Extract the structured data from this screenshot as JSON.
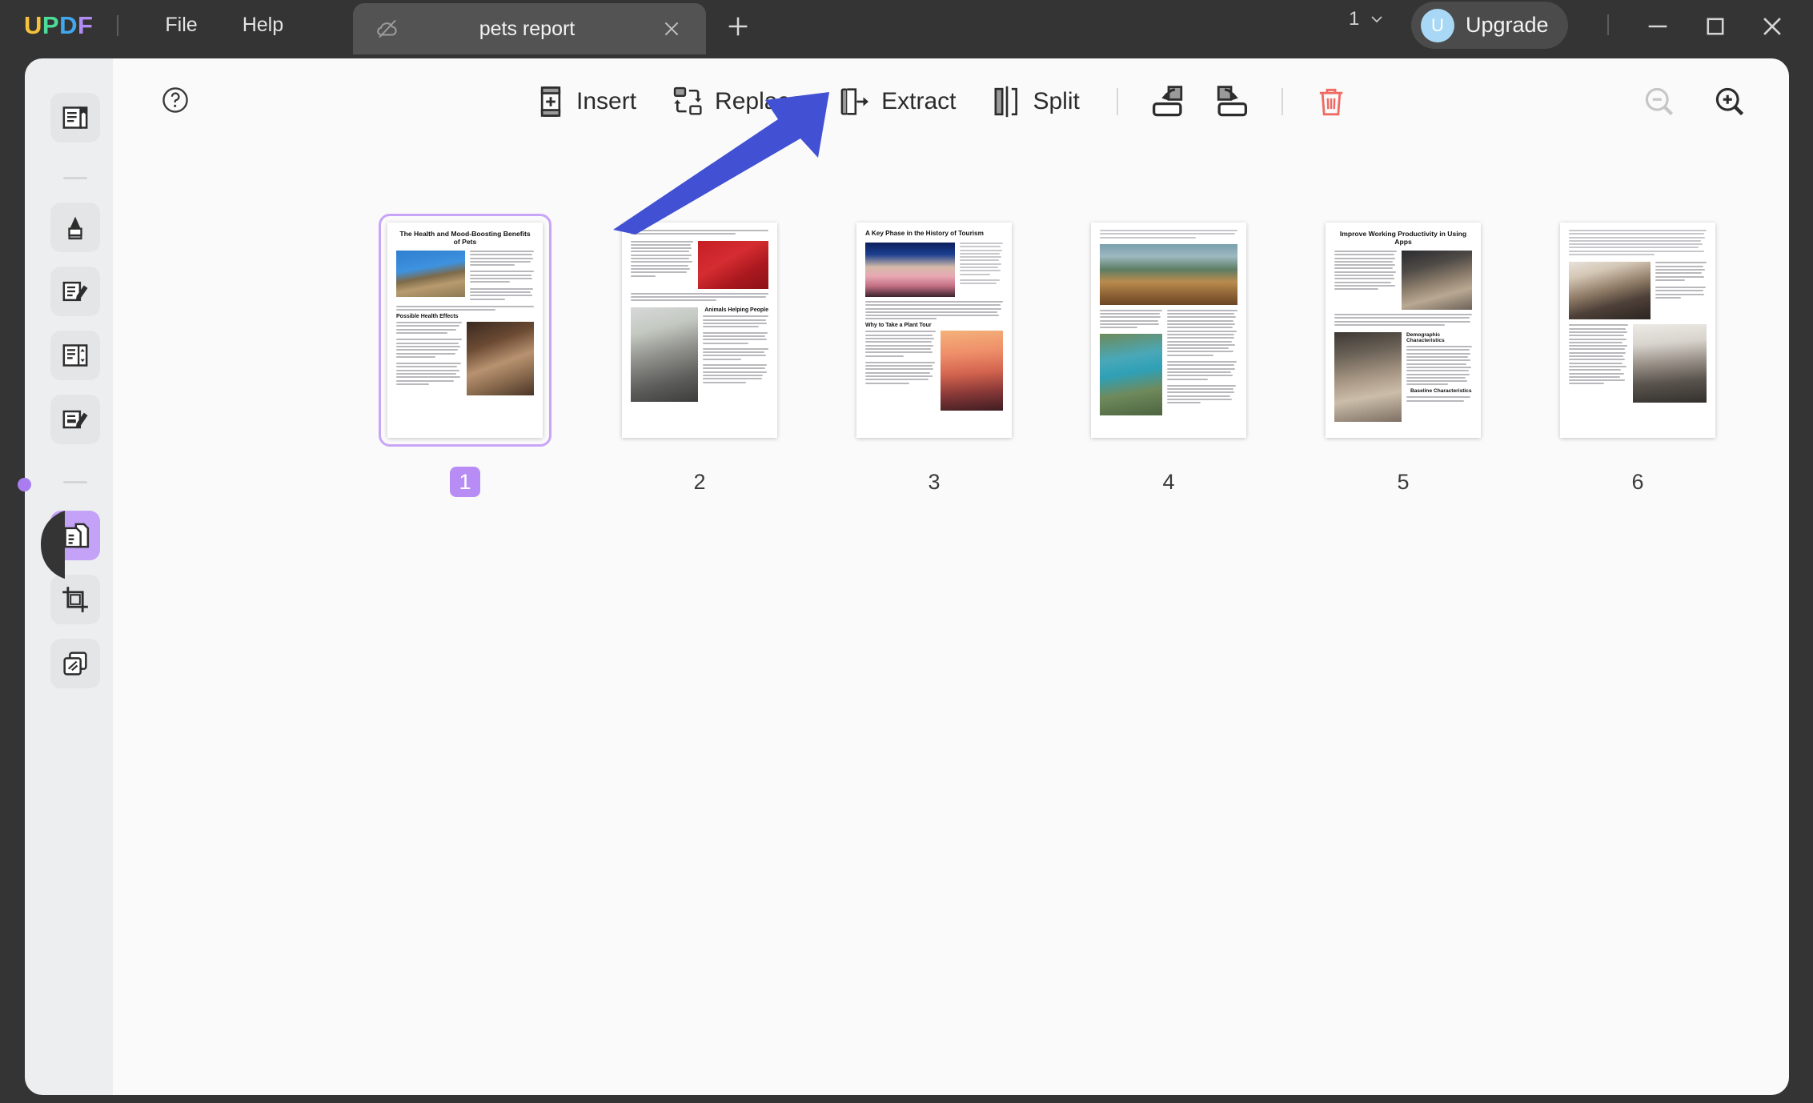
{
  "app": {
    "name": "UPDF",
    "logo_letters": [
      {
        "ch": "U",
        "color": "#f5c33b"
      },
      {
        "ch": "P",
        "color": "#4ddb9a"
      },
      {
        "ch": "D",
        "color": "#41a7ef"
      },
      {
        "ch": "F",
        "color": "#b18cf5"
      }
    ]
  },
  "titlebar": {
    "menus": [
      "File",
      "Help"
    ],
    "tab": {
      "title": "pets report",
      "cloud_icon": "cloud-slash-icon",
      "close_icon": "close-icon"
    },
    "new_tab_icon": "plus-icon",
    "page_count": "1",
    "page_count_chevron": "chevron-down-icon",
    "upgrade": {
      "avatar_letter": "U",
      "label": "Upgrade"
    },
    "window_controls": [
      "minimize-icon",
      "maximize-icon",
      "close-icon"
    ]
  },
  "sidebar": {
    "items": [
      {
        "name": "reader-mode",
        "icon": "book-bookmark-icon",
        "active": false
      },
      {
        "name": "divider-1",
        "icon": "divider",
        "active": false
      },
      {
        "name": "comment-highlight",
        "icon": "highlighter-icon",
        "active": false
      },
      {
        "name": "edit-pdf",
        "icon": "document-pencil-icon",
        "active": false
      },
      {
        "name": "read-layout",
        "icon": "document-sort-icon",
        "active": false
      },
      {
        "name": "annotate-form",
        "icon": "form-pencil-icon",
        "active": false
      },
      {
        "name": "divider-2",
        "icon": "divider",
        "active": false
      },
      {
        "name": "organize-pages",
        "icon": "pages-stack-icon",
        "active": true
      },
      {
        "name": "crop-page",
        "icon": "crop-icon",
        "active": false
      },
      {
        "name": "batch-process",
        "icon": "layers-icon",
        "active": false
      }
    ],
    "collapse_handle": "panel-collapse-handle",
    "active_color": "#c4a2f7"
  },
  "toolbar": {
    "help_icon": "help-circle-icon",
    "tools": [
      {
        "label": "Insert",
        "icon": "page-insert-icon"
      },
      {
        "label": "Replace",
        "icon": "page-replace-icon"
      },
      {
        "label": "Extract",
        "icon": "page-extract-icon"
      },
      {
        "label": "Split",
        "icon": "page-split-icon"
      }
    ],
    "rotate_left_icon": "rotate-left-icon",
    "rotate_right_icon": "rotate-right-icon",
    "delete_icon": "trash-icon",
    "delete_color": "#f06a63",
    "zoom_out_icon": "zoom-out-icon",
    "zoom_out_disabled": true,
    "zoom_in_icon": "zoom-in-icon"
  },
  "annotation": {
    "type": "arrow",
    "color": "#4250d3",
    "points_to": "Extract"
  },
  "pages": [
    {
      "number": "1",
      "selected": true,
      "title": "The Health and Mood-Boosting Benefits of Pets",
      "headings": [
        "Possible Health Effects"
      ],
      "photos": [
        "cat-on-blue-sky",
        "dog-and-cat-resting"
      ]
    },
    {
      "number": "2",
      "selected": false,
      "title": "",
      "headings": [
        "Animals Helping People"
      ],
      "photos": [
        "dog-in-costume-red-background",
        "gray-cat-with-tulips"
      ]
    },
    {
      "number": "3",
      "selected": false,
      "title": "A Key Phase in the History of Tourism",
      "headings": [
        "Why to Take a Plant Tour"
      ],
      "photos": [
        "havana-street-pink-car",
        "eiffel-tower-at-sunset"
      ]
    },
    {
      "number": "4",
      "selected": false,
      "title": "",
      "headings": [],
      "photos": [
        "mountain-lake-with-boat",
        "turquoise-canyon-river"
      ]
    },
    {
      "number": "5",
      "selected": false,
      "title": "Improve Working Productivity in Using Apps",
      "headings": [
        "Demographic Characteristics",
        "Baseline Characteristics"
      ],
      "photos": [
        "office-meeting-room",
        "team-working-at-desks"
      ]
    },
    {
      "number": "6",
      "selected": false,
      "title": "",
      "headings": [],
      "photos": [
        "smiling-woman-at-desk",
        "woman-writing-at-computer"
      ]
    }
  ]
}
